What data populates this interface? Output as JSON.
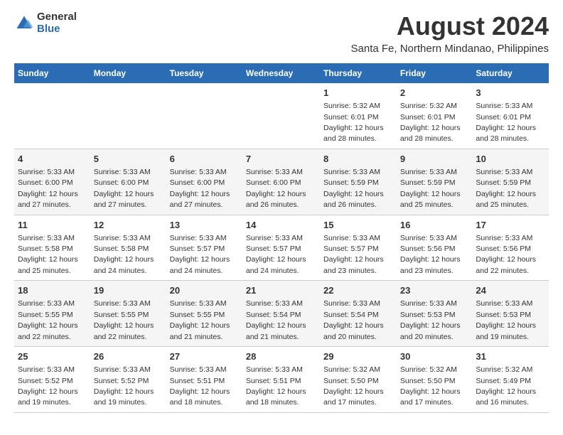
{
  "logo": {
    "general": "General",
    "blue": "Blue"
  },
  "title": "August 2024",
  "location": "Santa Fe, Northern Mindanao, Philippines",
  "days_of_week": [
    "Sunday",
    "Monday",
    "Tuesday",
    "Wednesday",
    "Thursday",
    "Friday",
    "Saturday"
  ],
  "weeks": [
    [
      {
        "day": "",
        "info": ""
      },
      {
        "day": "",
        "info": ""
      },
      {
        "day": "",
        "info": ""
      },
      {
        "day": "",
        "info": ""
      },
      {
        "day": "1",
        "info": "Sunrise: 5:32 AM\nSunset: 6:01 PM\nDaylight: 12 hours\nand 28 minutes."
      },
      {
        "day": "2",
        "info": "Sunrise: 5:32 AM\nSunset: 6:01 PM\nDaylight: 12 hours\nand 28 minutes."
      },
      {
        "day": "3",
        "info": "Sunrise: 5:33 AM\nSunset: 6:01 PM\nDaylight: 12 hours\nand 28 minutes."
      }
    ],
    [
      {
        "day": "4",
        "info": "Sunrise: 5:33 AM\nSunset: 6:00 PM\nDaylight: 12 hours\nand 27 minutes."
      },
      {
        "day": "5",
        "info": "Sunrise: 5:33 AM\nSunset: 6:00 PM\nDaylight: 12 hours\nand 27 minutes."
      },
      {
        "day": "6",
        "info": "Sunrise: 5:33 AM\nSunset: 6:00 PM\nDaylight: 12 hours\nand 27 minutes."
      },
      {
        "day": "7",
        "info": "Sunrise: 5:33 AM\nSunset: 6:00 PM\nDaylight: 12 hours\nand 26 minutes."
      },
      {
        "day": "8",
        "info": "Sunrise: 5:33 AM\nSunset: 5:59 PM\nDaylight: 12 hours\nand 26 minutes."
      },
      {
        "day": "9",
        "info": "Sunrise: 5:33 AM\nSunset: 5:59 PM\nDaylight: 12 hours\nand 25 minutes."
      },
      {
        "day": "10",
        "info": "Sunrise: 5:33 AM\nSunset: 5:59 PM\nDaylight: 12 hours\nand 25 minutes."
      }
    ],
    [
      {
        "day": "11",
        "info": "Sunrise: 5:33 AM\nSunset: 5:58 PM\nDaylight: 12 hours\nand 25 minutes."
      },
      {
        "day": "12",
        "info": "Sunrise: 5:33 AM\nSunset: 5:58 PM\nDaylight: 12 hours\nand 24 minutes."
      },
      {
        "day": "13",
        "info": "Sunrise: 5:33 AM\nSunset: 5:57 PM\nDaylight: 12 hours\nand 24 minutes."
      },
      {
        "day": "14",
        "info": "Sunrise: 5:33 AM\nSunset: 5:57 PM\nDaylight: 12 hours\nand 24 minutes."
      },
      {
        "day": "15",
        "info": "Sunrise: 5:33 AM\nSunset: 5:57 PM\nDaylight: 12 hours\nand 23 minutes."
      },
      {
        "day": "16",
        "info": "Sunrise: 5:33 AM\nSunset: 5:56 PM\nDaylight: 12 hours\nand 23 minutes."
      },
      {
        "day": "17",
        "info": "Sunrise: 5:33 AM\nSunset: 5:56 PM\nDaylight: 12 hours\nand 22 minutes."
      }
    ],
    [
      {
        "day": "18",
        "info": "Sunrise: 5:33 AM\nSunset: 5:55 PM\nDaylight: 12 hours\nand 22 minutes."
      },
      {
        "day": "19",
        "info": "Sunrise: 5:33 AM\nSunset: 5:55 PM\nDaylight: 12 hours\nand 22 minutes."
      },
      {
        "day": "20",
        "info": "Sunrise: 5:33 AM\nSunset: 5:55 PM\nDaylight: 12 hours\nand 21 minutes."
      },
      {
        "day": "21",
        "info": "Sunrise: 5:33 AM\nSunset: 5:54 PM\nDaylight: 12 hours\nand 21 minutes."
      },
      {
        "day": "22",
        "info": "Sunrise: 5:33 AM\nSunset: 5:54 PM\nDaylight: 12 hours\nand 20 minutes."
      },
      {
        "day": "23",
        "info": "Sunrise: 5:33 AM\nSunset: 5:53 PM\nDaylight: 12 hours\nand 20 minutes."
      },
      {
        "day": "24",
        "info": "Sunrise: 5:33 AM\nSunset: 5:53 PM\nDaylight: 12 hours\nand 19 minutes."
      }
    ],
    [
      {
        "day": "25",
        "info": "Sunrise: 5:33 AM\nSunset: 5:52 PM\nDaylight: 12 hours\nand 19 minutes."
      },
      {
        "day": "26",
        "info": "Sunrise: 5:33 AM\nSunset: 5:52 PM\nDaylight: 12 hours\nand 19 minutes."
      },
      {
        "day": "27",
        "info": "Sunrise: 5:33 AM\nSunset: 5:51 PM\nDaylight: 12 hours\nand 18 minutes."
      },
      {
        "day": "28",
        "info": "Sunrise: 5:33 AM\nSunset: 5:51 PM\nDaylight: 12 hours\nand 18 minutes."
      },
      {
        "day": "29",
        "info": "Sunrise: 5:32 AM\nSunset: 5:50 PM\nDaylight: 12 hours\nand 17 minutes."
      },
      {
        "day": "30",
        "info": "Sunrise: 5:32 AM\nSunset: 5:50 PM\nDaylight: 12 hours\nand 17 minutes."
      },
      {
        "day": "31",
        "info": "Sunrise: 5:32 AM\nSunset: 5:49 PM\nDaylight: 12 hours\nand 16 minutes."
      }
    ]
  ]
}
